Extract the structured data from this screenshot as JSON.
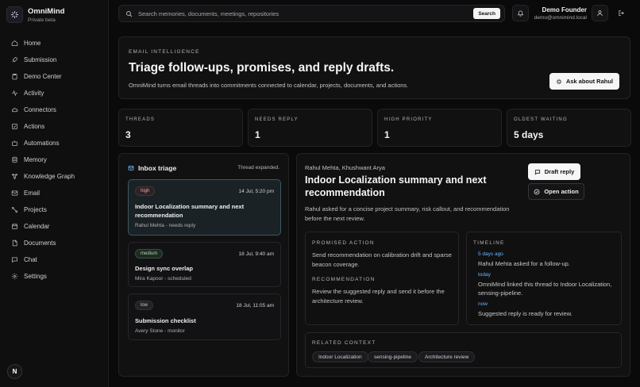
{
  "brand": {
    "title": "OmniMind",
    "subtitle": "Private beta",
    "avatar_letter": "N"
  },
  "sidebar": {
    "items": [
      {
        "label": "Home",
        "icon": "home-icon"
      },
      {
        "label": "Submission",
        "icon": "rocket-icon"
      },
      {
        "label": "Demo Center",
        "icon": "clipboard-icon"
      },
      {
        "label": "Activity",
        "icon": "activity-icon"
      },
      {
        "label": "Connectors",
        "icon": "cloud-icon"
      },
      {
        "label": "Actions",
        "icon": "checkbox-icon"
      },
      {
        "label": "Automations",
        "icon": "bot-icon"
      },
      {
        "label": "Memory",
        "icon": "database-icon"
      },
      {
        "label": "Knowledge Graph",
        "icon": "graph-icon"
      },
      {
        "label": "Email",
        "icon": "mail-icon"
      },
      {
        "label": "Projects",
        "icon": "network-icon"
      },
      {
        "label": "Calendar",
        "icon": "calendar-icon"
      },
      {
        "label": "Documents",
        "icon": "file-icon"
      },
      {
        "label": "Chat",
        "icon": "chat-icon"
      },
      {
        "label": "Settings",
        "icon": "gear-icon"
      }
    ]
  },
  "topbar": {
    "search_placeholder": "Search memories, documents, meetings, repositories",
    "search_button": "Search",
    "user_name": "Demo Founder",
    "user_email": "demo@omnimind.local"
  },
  "hero": {
    "eyebrow": "EMAIL INTELLIGENCE",
    "title": "Triage follow-ups, promises, and reply drafts.",
    "description": "OmniMind turns email threads into commitments connected to calendar, projects, documents, and actions.",
    "ask_button": "Ask about Rahul"
  },
  "stats": [
    {
      "label": "THREADS",
      "value": "3"
    },
    {
      "label": "NEEDS REPLY",
      "value": "1"
    },
    {
      "label": "HIGH PRIORITY",
      "value": "1"
    },
    {
      "label": "OLDEST WAITING",
      "value": "5 days"
    }
  ],
  "inbox": {
    "title": "Inbox triage",
    "status": "Thread expanded.",
    "threads": [
      {
        "priority": "high",
        "date": "14 Jul, 5:20 pm",
        "title": "Indoor Localization summary and next recommendation",
        "meta": "Rahul Mehta - needs reply"
      },
      {
        "priority": "medium",
        "date": "18 Jul, 9:40 am",
        "title": "Design sync overlap",
        "meta": "Mira Kapoor - scheduled"
      },
      {
        "priority": "low",
        "date": "18 Jul, 11:05 am",
        "title": "Submission checklist",
        "meta": "Avery Stone - monitor"
      }
    ]
  },
  "detail": {
    "people": "Rahul Mehta, Khushwant Arya",
    "title": "Indoor Localization summary and next recommendation",
    "description": "Rahul asked for a concise project summary, risk callout, and recommendation before the next review.",
    "draft_button": "Draft reply",
    "open_button": "Open action",
    "promised_label": "PROMISED ACTION",
    "promised_text": "Send recommendation on calibration drift and sparse beacon coverage.",
    "recommendation_label": "RECOMMENDATION",
    "recommendation_text": "Review the suggested reply and send it before the architecture review.",
    "timeline_label": "TIMELINE",
    "timeline": [
      {
        "time": "5 days ago",
        "text": "Rahul Mehta asked for a follow-up."
      },
      {
        "time": "today",
        "text": "OmniMind linked this thread to Indoor Localization, sensing-pipeline."
      },
      {
        "time": "now",
        "text": "Suggested reply is ready for review."
      }
    ],
    "context_label": "RELATED CONTEXT",
    "context_chips": [
      "Indoor Localization",
      "sensing-pipeline",
      "Architecture review"
    ]
  }
}
